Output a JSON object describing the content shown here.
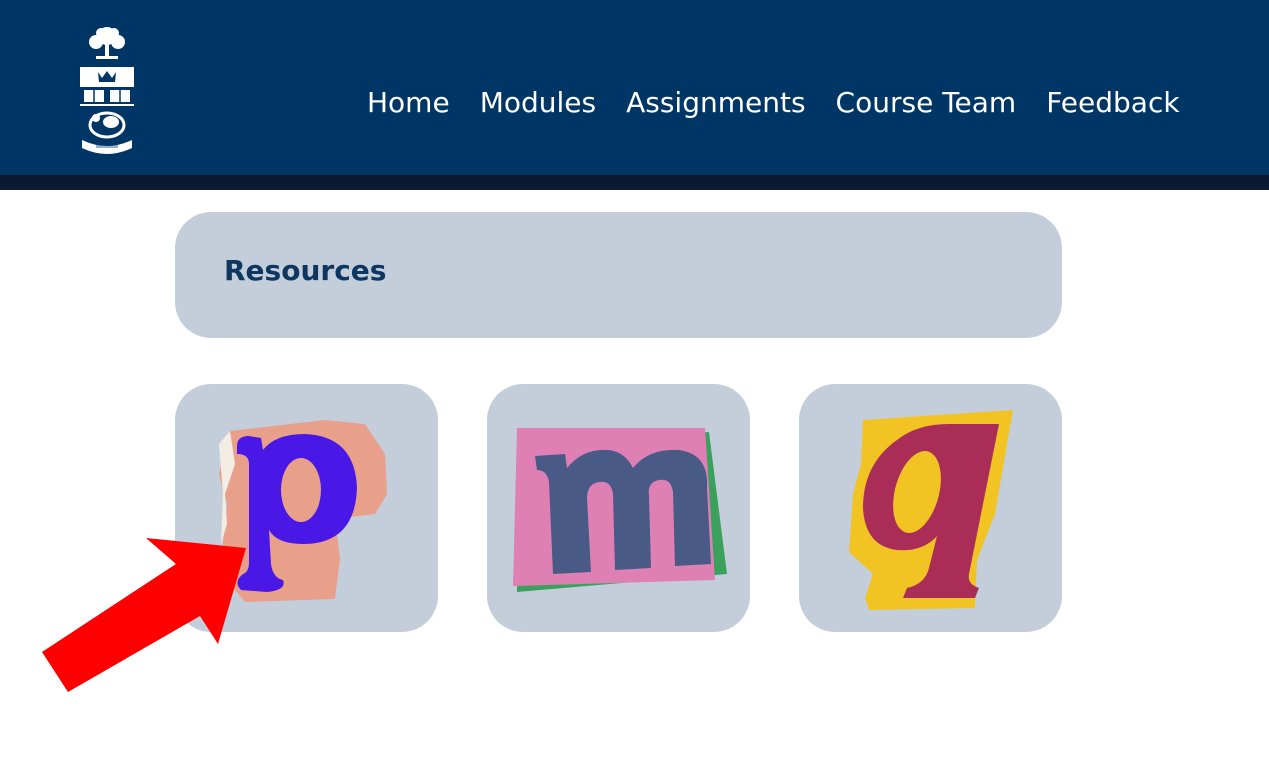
{
  "nav": {
    "items": [
      {
        "label": "Home"
      },
      {
        "label": "Modules"
      },
      {
        "label": "Assignments"
      },
      {
        "label": "Course Team"
      },
      {
        "label": "Feedback"
      }
    ]
  },
  "resources": {
    "title": "Resources"
  },
  "cards": [
    {
      "letter": "p",
      "icon": "letter-p-cutout-icon"
    },
    {
      "letter": "m",
      "icon": "letter-m-cutout-icon"
    },
    {
      "letter": "q",
      "icon": "letter-q-cutout-icon"
    }
  ],
  "colors": {
    "header": "#003666",
    "header_shadow": "#0b1a30",
    "card_bg": "#c4cedb",
    "title": "#0d3660",
    "arrow": "#ff0000"
  }
}
